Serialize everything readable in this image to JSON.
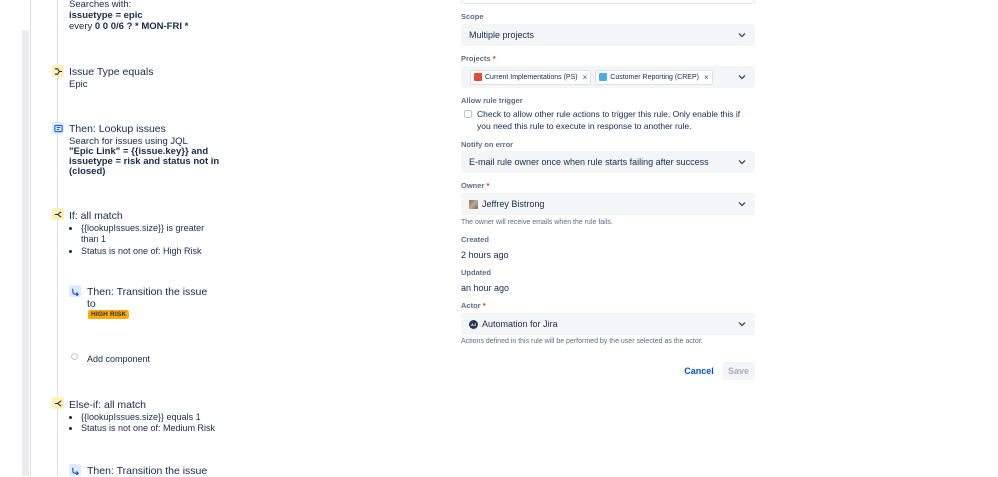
{
  "left_panel": {
    "search_block": {
      "searches_label": "Searches with:",
      "jql": "issuetype = epic",
      "cron_prefix": "every",
      "cron": "0 0 0/6 ? * MON-FRI *"
    },
    "node_issue_type": {
      "title": "Issue Type equals",
      "value": "Epic"
    },
    "node_lookup": {
      "title": "Then: Lookup issues",
      "line1": "Search for issues using JQL",
      "jql_line1": "\"Epic Link\" = {{issue.key}} and",
      "jql_line2": "issuetype = risk and status not in",
      "jql_line3": "(closed)"
    },
    "node_if": {
      "title": "If: all match",
      "cond1_line1": "{{lookupIssues.size}} is greater",
      "cond1_line2": "than 1",
      "cond2": "Status is not one of: High Risk"
    },
    "node_transition1": {
      "title_line1": "Then: Transition the issue",
      "title_line2": "to",
      "badge": "HIGH RISK"
    },
    "add_component": "Add component",
    "node_else_if": {
      "title": "Else-if: all match",
      "cond1": "{{lookupIssues.size}} equals 1",
      "cond2": "Status is not one of: Medium Risk"
    },
    "node_transition2": {
      "title": "Then: Transition the issue"
    }
  },
  "form": {
    "scope": {
      "label": "Scope",
      "value": "Multiple projects"
    },
    "projects": {
      "label": "Projects",
      "required_mark": "*",
      "tags": [
        {
          "label": "Current Implementations (PS)",
          "color": "#e5493a"
        },
        {
          "label": "Customer Reporting (CREP)",
          "color": "#4bade8"
        }
      ],
      "remove_glyph": "×"
    },
    "allow_trigger": {
      "label": "Allow rule trigger",
      "text_line1": "Check to allow other rule actions to trigger this rule. Only enable this if",
      "text_line2": "you need this rule to execute in response to another rule."
    },
    "notify": {
      "label": "Notify on error",
      "value": "E-mail rule owner once when rule starts failing after success"
    },
    "owner": {
      "label": "Owner",
      "required_mark": "*",
      "value": "Jeffrey Bistrong",
      "helper": "The owner will receive emails when the rule fails."
    },
    "created": {
      "label": "Created",
      "value": "2 hours ago"
    },
    "updated": {
      "label": "Updated",
      "value": "an hour ago"
    },
    "actor": {
      "label": "Actor",
      "required_mark": "*",
      "value": "Automation for Jira",
      "avatar_text": "AJ",
      "helper": "Actions defined in this rule will be performed by the user selected as the actor."
    },
    "buttons": {
      "cancel": "Cancel",
      "save": "Save"
    }
  },
  "colors": {
    "link_blue": "#0052cc",
    "badge_yellow": "#ffab00",
    "field_bg": "#f4f5f7",
    "label_gray": "#5e6c84"
  },
  "icons": [
    "branch-icon",
    "lookup-icon",
    "transition-icon",
    "chevron-down-icon",
    "close-icon",
    "checkbox-icon"
  ]
}
